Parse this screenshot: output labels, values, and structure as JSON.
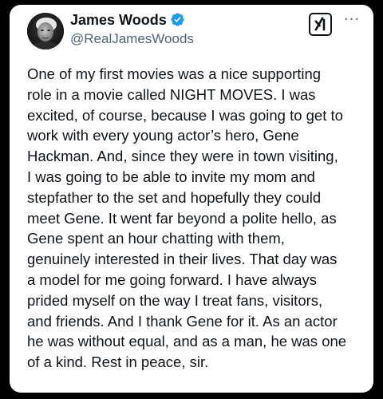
{
  "author": {
    "name": "James Woods",
    "handle": "@RealJamesWoods",
    "verified": true,
    "verified_color": "#1d9bf0",
    "avatar": "avatar-photo"
  },
  "actions": {
    "grok_icon": "grok-icon",
    "more_icon": "more-icon",
    "more_glyph": "···"
  },
  "post": {
    "lines": [
      "One of my first movies was a nice supporting",
      "role in a movie called NIGHT MOVES. I was",
      "excited, of course, because I was going to get to",
      "work with every young actor’s hero, Gene",
      "Hackman. And, since they were in town visiting,",
      "I was going to be able to invite my mom and",
      "stepfather to the set and hopefully they could",
      "meet Gene. It went far beyond a polite hello, as",
      "Gene spent an hour chatting with them,",
      "genuinely interested in their lives. That day was",
      "a model for me going forward. I have always",
      "prided myself on the way I treat fans, visitors,",
      "and friends. And I thank Gene for it. As an actor",
      "he was without equal, and as a man, he was one",
      "of a kind. Rest in peace, sir."
    ]
  },
  "colors": {
    "text": "#0f1419",
    "secondary": "#536471",
    "background": "#ffffff",
    "frame": "#000000"
  }
}
